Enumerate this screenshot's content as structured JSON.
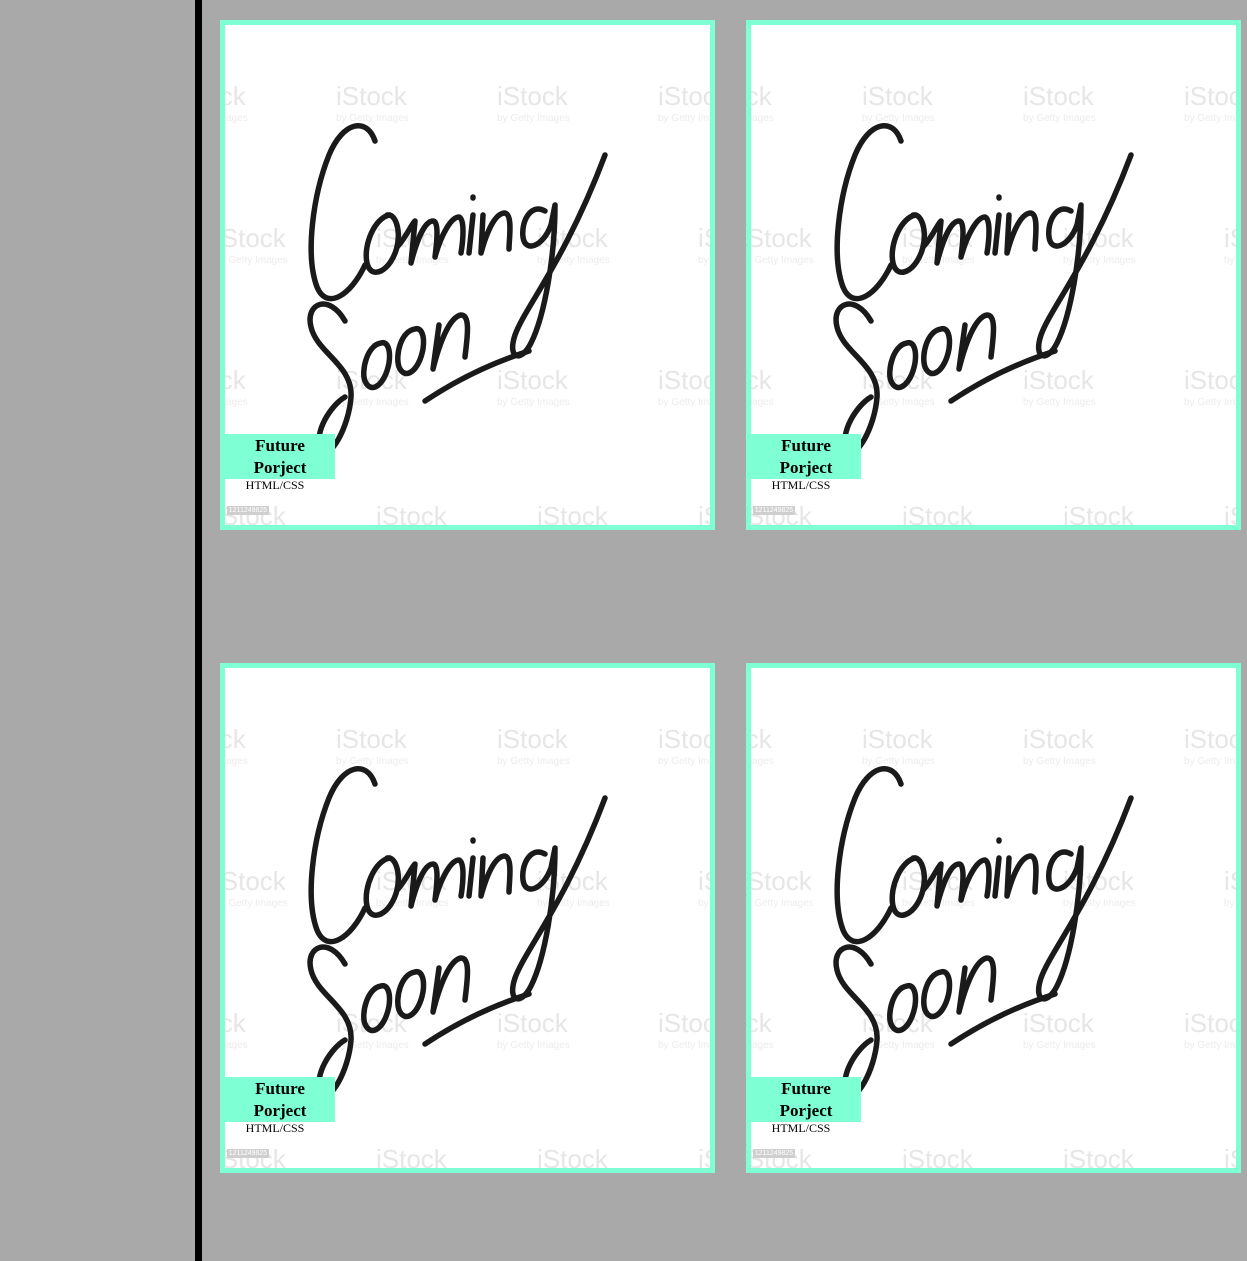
{
  "colors": {
    "background": "#a9a9a9",
    "divider": "#000000",
    "card_border": "#7fffd4",
    "label_bg": "#7fffd4"
  },
  "projects": [
    {
      "image_text": [
        "Coming",
        "Soon"
      ],
      "title": "Future Porject",
      "subtitle": "HTML/CSS",
      "watermark": "iStock",
      "watermark_sub": "by Getty Images",
      "stock_id": "1211249825"
    },
    {
      "image_text": [
        "Coming",
        "Soon"
      ],
      "title": "Future Porject",
      "subtitle": "HTML/CSS",
      "watermark": "iStock",
      "watermark_sub": "by Getty Images",
      "stock_id": "1211249825"
    },
    {
      "image_text": [
        "Coming",
        "Soon"
      ],
      "title": "Future Porject",
      "subtitle": "HTML/CSS",
      "watermark": "iStock",
      "watermark_sub": "by Getty Images",
      "stock_id": "1211249825"
    },
    {
      "image_text": [
        "Coming",
        "Soon"
      ],
      "title": "Future Porject",
      "subtitle": "HTML/CSS",
      "watermark": "iStock",
      "watermark_sub": "by Getty Images",
      "stock_id": "1211249825"
    }
  ]
}
